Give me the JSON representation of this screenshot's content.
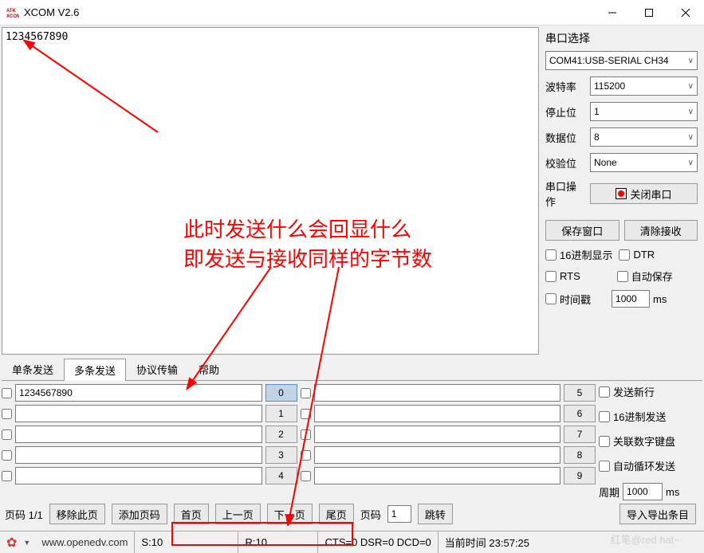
{
  "title": "XCOM V2.6",
  "output_text": "1234567890",
  "sidebar": {
    "port_title": "串口选择",
    "port_value": "COM41:USB-SERIAL CH34",
    "baud_label": "波特率",
    "baud_value": "115200",
    "stop_label": "停止位",
    "stop_value": "1",
    "data_label": "数据位",
    "data_value": "8",
    "parity_label": "校验位",
    "parity_value": "None",
    "op_label": "串口操作",
    "close_btn": "关闭串口",
    "save_btn": "保存窗口",
    "clear_btn": "清除接收",
    "hex_disp": "16进制显示",
    "dtr": "DTR",
    "rts": "RTS",
    "autosave": "自动保存",
    "timestamp": "时间戳",
    "ts_value": "1000",
    "ts_unit": "ms"
  },
  "tabs": [
    "单条发送",
    "多条发送",
    "协议传输",
    "帮助"
  ],
  "send": {
    "left_rows": [
      "1234567890",
      "",
      "",
      "",
      ""
    ],
    "left_nums": [
      "0",
      "1",
      "2",
      "3",
      "4"
    ],
    "right_rows": [
      "",
      "",
      "",
      "",
      ""
    ],
    "right_nums": [
      "5",
      "6",
      "7",
      "8",
      "9"
    ],
    "opts": {
      "newline": "发送新行",
      "hexsend": "16进制发送",
      "numpad": "关联数字键盘",
      "autoloop": "自动循环发送",
      "period_label": "周期",
      "period_value": "1000",
      "period_unit": "ms"
    }
  },
  "pagebar": {
    "pageinfo": "页码 1/1",
    "remove": "移除此页",
    "add": "添加页码",
    "first": "首页",
    "prev": "上一页",
    "next": "下一页",
    "last": "尾页",
    "goto_label": "页码",
    "goto_value": "1",
    "goto_btn": "跳转",
    "export": "导入导出条目"
  },
  "status": {
    "url": "www.openedv.com",
    "s": "S:10",
    "r": "R:10",
    "cts": "CTS=0 DSR=0 DCD=0",
    "time": "当前时间 23:57:25"
  },
  "annotation": {
    "line1": "此时发送什么会回显什么",
    "line2": "即发送与接收同样的字节数"
  },
  "watermark": "红笔@red hat~"
}
